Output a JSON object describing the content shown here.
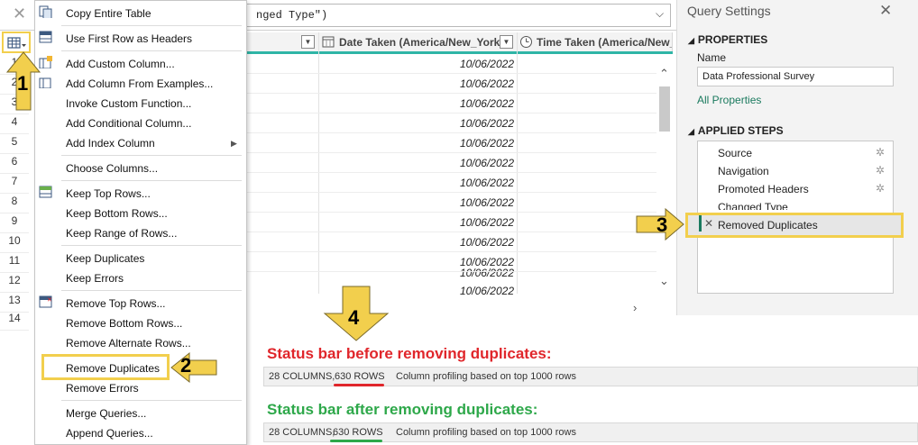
{
  "formula_bar": {
    "close_icon": "close-icon",
    "formula_text": "nged Type\")"
  },
  "grid": {
    "columns": [
      {
        "name": "Date Taken (America/New_York)",
        "type_icon": "calendar-icon"
      },
      {
        "name": "Time Taken (America/New_Yo",
        "type_icon": "clock-icon"
      }
    ],
    "row_numbers": [
      "1",
      "2",
      "3",
      "4",
      "5",
      "6",
      "7",
      "8",
      "9",
      "10",
      "11",
      "12",
      "13",
      "14"
    ],
    "date_values": [
      "10/06/2022",
      "10/06/2022",
      "10/06/2022",
      "10/06/2022",
      "10/06/2022",
      "10/06/2022",
      "10/06/2022",
      "10/06/2022",
      "10/06/2022",
      "10/06/2022",
      "10/06/2022",
      "10/06/2022",
      "10/06/2022"
    ]
  },
  "context_menu": {
    "items": [
      {
        "label": "Copy Entire Table"
      },
      {
        "label": "Use First Row as Headers"
      },
      {
        "label": "Add Custom Column..."
      },
      {
        "label": "Add Column From Examples..."
      },
      {
        "label": "Invoke Custom Function..."
      },
      {
        "label": "Add Conditional Column..."
      },
      {
        "label": "Add Index Column"
      },
      {
        "label": "Choose Columns..."
      },
      {
        "label": "Keep Top Rows..."
      },
      {
        "label": "Keep Bottom Rows..."
      },
      {
        "label": "Keep Range of Rows..."
      },
      {
        "label": "Keep Duplicates"
      },
      {
        "label": "Keep Errors"
      },
      {
        "label": "Remove Top Rows..."
      },
      {
        "label": "Remove Bottom Rows..."
      },
      {
        "label": "Remove Alternate Rows..."
      },
      {
        "label": "Remove Duplicates"
      },
      {
        "label": "Remove Errors"
      },
      {
        "label": "Merge Queries..."
      },
      {
        "label": "Append Queries..."
      }
    ]
  },
  "query_settings": {
    "title": "Query Settings",
    "properties_heading": "PROPERTIES",
    "name_label": "Name",
    "name_value": "Data Professional Survey",
    "all_properties_link": "All Properties",
    "applied_steps_heading": "APPLIED STEPS",
    "steps": [
      {
        "label": "Source"
      },
      {
        "label": "Navigation"
      },
      {
        "label": "Promoted Headers"
      },
      {
        "label": "Changed Type"
      },
      {
        "label": "Removed Duplicates"
      }
    ]
  },
  "callouts": [
    "1",
    "2",
    "3",
    "4"
  ],
  "status_before": {
    "title": "Status bar before removing duplicates:",
    "title_color": "#e0262b",
    "columns": "28 COLUMNS,",
    "rows": "630 ROWS",
    "profiling": "Column profiling based on top 1000 rows",
    "underline_color": "#e0262b"
  },
  "status_after": {
    "title": "Status bar after removing duplicates:",
    "title_color": "#2ea84a",
    "columns": "28 COLUMNS,",
    "rows": "630 ROWS",
    "profiling": "Column profiling based on top 1000 rows",
    "underline_color": "#2ea84a"
  },
  "colors": {
    "highlight": "#f2cf4d",
    "teal": "#2fb5a6",
    "link": "#1a7a5e"
  }
}
